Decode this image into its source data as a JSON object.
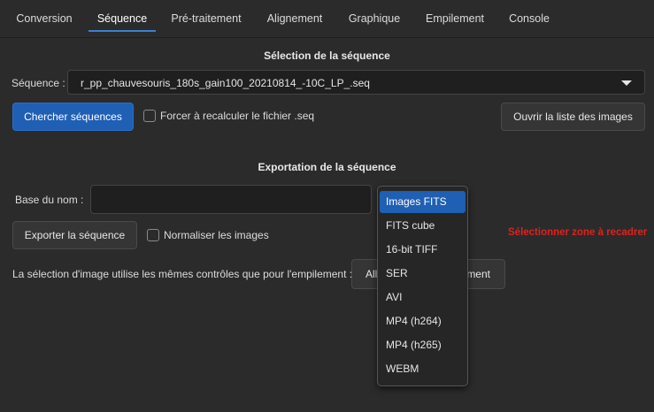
{
  "tabs": [
    {
      "label": "Conversion"
    },
    {
      "label": "Séquence"
    },
    {
      "label": "Pré-traitement"
    },
    {
      "label": "Alignement"
    },
    {
      "label": "Graphique"
    },
    {
      "label": "Empilement"
    },
    {
      "label": "Console"
    }
  ],
  "active_tab": "Séquence",
  "sequence_section": {
    "title": "Sélection de la séquence",
    "sequence_label": "Séquence :",
    "sequence_value": "r_pp_chauvesouris_180s_gain100_20210814_-10C_LP_.seq",
    "search_button": "Chercher séquences",
    "force_recalc_label": "Forcer à recalculer le fichier .seq",
    "force_recalc_checked": false,
    "open_list_button": "Ouvrir la liste des images"
  },
  "export_section": {
    "title": "Exportation de la séquence",
    "base_name_label": "Base du nom :",
    "base_name_value": "",
    "export_button": "Exporter la séquence",
    "normalize_label": "Normaliser les images",
    "normalize_checked": false,
    "select_zone_warning": "Sélectionner zone à recadrer",
    "selection_note": "La sélection d'image utilise les mêmes contrôles que pour l'empilement :",
    "stacking_button_left": "All",
    "stacking_button_right": "ment",
    "format_options": [
      "Images FITS",
      "FITS cube",
      "16-bit TIFF",
      "SER",
      "AVI",
      "MP4 (h264)",
      "MP4 (h265)",
      "WEBM"
    ],
    "format_selected": "Images FITS"
  },
  "colors": {
    "accent": "#1f5fb4",
    "warning": "#e0211d",
    "background": "#2b2b2b"
  }
}
